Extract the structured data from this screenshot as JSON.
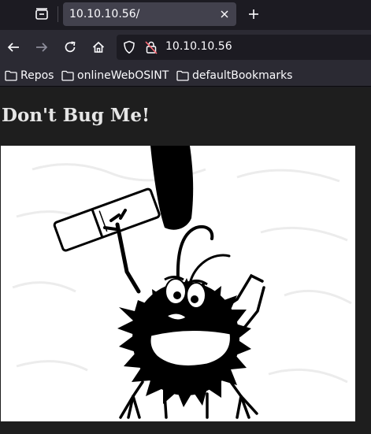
{
  "browser": {
    "tab": {
      "title": "10.10.10.56/"
    },
    "url": "10.10.10.56",
    "bookmarks": [
      {
        "label": "Repos"
      },
      {
        "label": "onlineWebOSINT"
      },
      {
        "label": "defaultBookmarks"
      }
    ]
  },
  "page": {
    "heading": "Don't Bug Me!"
  },
  "colors": {
    "chrome_bg": "#1c1b22",
    "toolbar_bg": "#2b2a33",
    "tab_active_bg": "#42414d",
    "content_bg": "#1e1e1e",
    "text": "#fbfbfe"
  },
  "icons": {
    "tab_list": "tab-list-icon",
    "tab_close": "close-icon",
    "new_tab": "plus-icon",
    "back": "arrow-left-icon",
    "forward": "arrow-right-icon",
    "reload": "reload-icon",
    "home": "home-icon",
    "tracking_protection": "shield-icon",
    "insecure": "lock-strike-icon",
    "bookmark_folder": "folder-icon"
  }
}
